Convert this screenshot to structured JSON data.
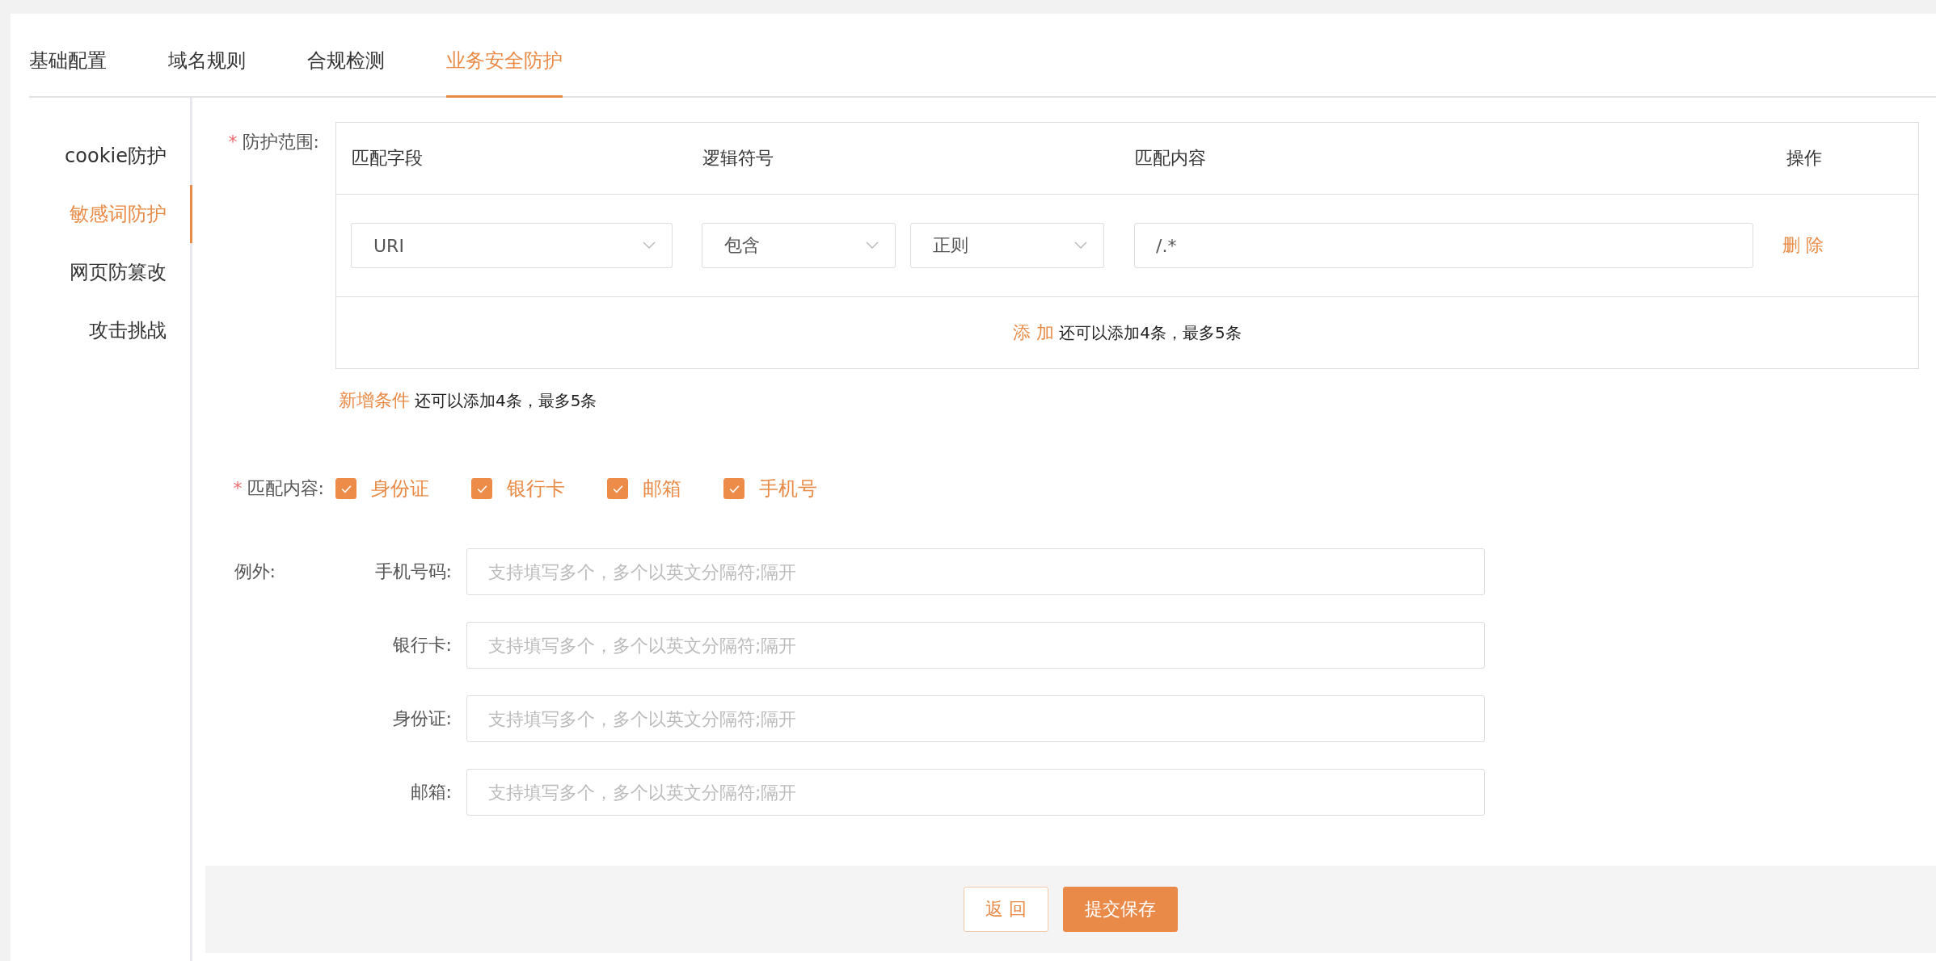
{
  "tabs": [
    {
      "label": "基础配置",
      "selected": false
    },
    {
      "label": "域名规则",
      "selected": false
    },
    {
      "label": "合规检测",
      "selected": false
    },
    {
      "label": "业务安全防护",
      "selected": true
    }
  ],
  "sidebar": {
    "items": [
      {
        "label": "cookie防护",
        "selected": false
      },
      {
        "label": "敏感词防护",
        "selected": true
      },
      {
        "label": "网页防篡改",
        "selected": false
      },
      {
        "label": "攻击挑战",
        "selected": false
      }
    ]
  },
  "scope": {
    "required_mark": "*",
    "label": "防护范围:",
    "columns": [
      "匹配字段",
      "逻辑符号",
      "匹配内容",
      "操作"
    ],
    "rows": [
      {
        "field": "URI",
        "operator": "包含",
        "mode": "正则",
        "content": "/.*",
        "action": "删 除"
      }
    ],
    "add_row": {
      "link": "添 加",
      "hint": "还可以添加4条，最多5条"
    }
  },
  "add_condition": {
    "link": "新增条件",
    "hint": "还可以添加4条，最多5条"
  },
  "match_content": {
    "required_mark": "*",
    "label": "匹配内容:",
    "options": [
      {
        "label": "身份证",
        "checked": true
      },
      {
        "label": "银行卡",
        "checked": true
      },
      {
        "label": "邮箱",
        "checked": true
      },
      {
        "label": "手机号",
        "checked": true
      }
    ]
  },
  "exceptions": {
    "label": "例外:",
    "fields": [
      {
        "label": "手机号码:",
        "placeholder": "支持填写多个，多个以英文分隔符;隔开"
      },
      {
        "label": "银行卡:",
        "placeholder": "支持填写多个，多个以英文分隔符;隔开"
      },
      {
        "label": "身份证:",
        "placeholder": "支持填写多个，多个以英文分隔符;隔开"
      },
      {
        "label": "邮箱:",
        "placeholder": "支持填写多个，多个以英文分隔符;隔开"
      }
    ]
  },
  "buttons": [
    {
      "label": "返 回",
      "kind": "secondary"
    },
    {
      "label": "提交保存",
      "kind": "primary"
    }
  ]
}
